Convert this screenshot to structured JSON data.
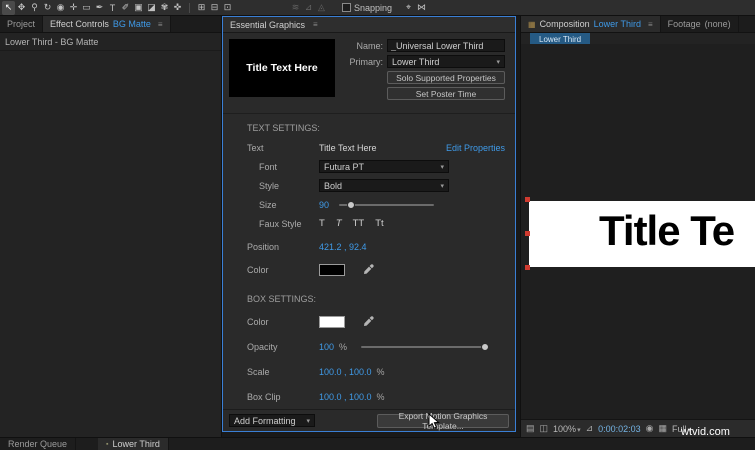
{
  "icons": {
    "chevron_down": "▾",
    "menu": "≡",
    "comp": "▦",
    "square": "▪"
  },
  "toolbar": {
    "tools": [
      {
        "glyph": "↖"
      },
      {
        "glyph": "✥"
      },
      {
        "glyph": "⚲"
      },
      {
        "glyph": "↻"
      },
      {
        "glyph": "◉"
      },
      {
        "glyph": "✛"
      },
      {
        "glyph": "▭"
      },
      {
        "glyph": "✒"
      },
      {
        "glyph": "T"
      },
      {
        "glyph": "✐"
      },
      {
        "glyph": "▣"
      },
      {
        "glyph": "◪"
      },
      {
        "glyph": "✾"
      },
      {
        "glyph": "✜"
      }
    ],
    "mid_icons": [
      {
        "glyph": "⊞"
      },
      {
        "glyph": "⊟"
      },
      {
        "glyph": "⊡"
      }
    ],
    "dim_icons": [
      {
        "glyph": "≋"
      },
      {
        "glyph": "⊿"
      },
      {
        "glyph": "◬"
      }
    ],
    "right_icons": [
      {
        "glyph": "⌖"
      },
      {
        "glyph": "⋈"
      }
    ],
    "snapping_label": "Snapping"
  },
  "left_panel": {
    "tab_project": "Project",
    "tab_effect_controls": "Effect Controls",
    "tab_effect_target": "BG Matte",
    "source_item": "Lower Third - BG Matte"
  },
  "eg": {
    "title": "Essential Graphics",
    "preview_text": "Title Text Here",
    "name_label": "Name:",
    "name_value": "_Universal Lower Third",
    "primary_label": "Primary:",
    "primary_value": "Lower Third",
    "solo_button": "Solo Supported Properties",
    "poster_button": "Set Poster Time",
    "text_settings_header": "TEXT SETTINGS:",
    "box_settings_header": "BOX SETTINGS:",
    "rows": {
      "text": {
        "label": "Text",
        "value": "Title Text Here",
        "edit_link": "Edit Properties"
      },
      "font": {
        "label": "Font",
        "value": "Futura PT"
      },
      "style": {
        "label": "Style",
        "value": "Bold"
      },
      "size": {
        "label": "Size",
        "value": "90"
      },
      "faux": {
        "label": "Faux Style",
        "opt1": "T",
        "opt2": "T",
        "opt3": "TT",
        "opt4": "Tt"
      },
      "position": {
        "label": "Position",
        "value": "421.2 , 92.4"
      },
      "text_color": {
        "label": "Color",
        "hex": "#000000"
      },
      "box_color": {
        "label": "Color",
        "hex": "#ffffff"
      },
      "opacity": {
        "label": "Opacity",
        "value": "100",
        "unit": "%"
      },
      "scale": {
        "label": "Scale",
        "value": "100.0 , 100.0",
        "unit": "%"
      },
      "box_clip": {
        "label": "Box Clip",
        "value": "100.0 , 100.0",
        "unit": "%"
      }
    },
    "add_formatting": "Add Formatting",
    "export_button": "Export Motion Graphics Template..."
  },
  "comp": {
    "tab_label": "Composition",
    "tab_name": "Lower Third",
    "footage_label": "Footage",
    "footage_name": "(none)",
    "viewer_tab": "Lower Third",
    "canvas_text": "Title Te",
    "zoom": "100%",
    "timecode": "0:00:02:03",
    "resolution": "Full",
    "status_icons": {
      "pixel_aspect": "▤",
      "roi": "◫",
      "mag": "⊿",
      "snapshot": "◉",
      "channels": "▦"
    }
  },
  "bottom": {
    "tab_render_queue": "Render Queue",
    "tab_lower_third": "Lower Third"
  },
  "watermark": "wtvid.com",
  "colors": {
    "accent_blue": "#3f9ae8",
    "focus_border": "#3a7fd5",
    "handle_red": "#cf3b30"
  }
}
